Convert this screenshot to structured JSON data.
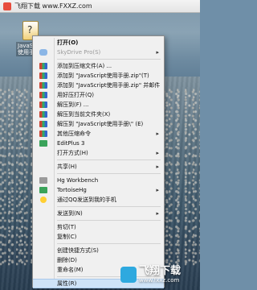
{
  "window": {
    "title": "飞翔下载 www.FXXZ.com"
  },
  "desktop": {
    "icon_label": "JavaScript使用手册"
  },
  "context_menu": {
    "items": [
      {
        "label": "打开(O)",
        "bold": true,
        "icon": "",
        "arrow": false,
        "disabled": false
      },
      {
        "label": "SkyDrive Pro(S)",
        "icon": "skydrive-icon",
        "arrow": true,
        "disabled": true
      },
      {
        "sep": true
      },
      {
        "label": "添加到压缩文件(A) ...",
        "icon": "rar-books-icon"
      },
      {
        "label": "添加到 \"JavaScript使用手册.zip\"(T)",
        "icon": "rar-books-icon"
      },
      {
        "label": "添加到 \"JavaScript使用手册.zip\" 并邮件",
        "icon": "rar-books-icon"
      },
      {
        "label": "用好压打开(Q)",
        "icon": "rar-books-icon"
      },
      {
        "label": "解压到(F) ...",
        "icon": "rar-books-icon"
      },
      {
        "label": "解压到当前文件夹(X)",
        "icon": "rar-books-icon"
      },
      {
        "label": "解压到 \"JavaScript使用手册\\\" (E)",
        "icon": "rar-books-icon"
      },
      {
        "label": "其他压缩命令",
        "icon": "rar-books-icon",
        "arrow": true
      },
      {
        "label": "EditPlus 3",
        "icon": "editplus-icon"
      },
      {
        "label": "打开方式(H)",
        "icon": "",
        "arrow": true
      },
      {
        "sep": true
      },
      {
        "label": "共享(H)",
        "icon": "",
        "arrow": true
      },
      {
        "sep": true
      },
      {
        "label": "Hg Workbench",
        "icon": "hg-icon"
      },
      {
        "label": "TortoiseHg",
        "icon": "tortoisehg-icon",
        "arrow": true
      },
      {
        "label": "通过QQ发送到我的手机",
        "icon": "qq-icon"
      },
      {
        "sep": true
      },
      {
        "label": "发送到(N)",
        "icon": "",
        "arrow": true
      },
      {
        "sep": true
      },
      {
        "label": "剪切(T)",
        "icon": ""
      },
      {
        "label": "复制(C)",
        "icon": ""
      },
      {
        "sep": true
      },
      {
        "label": "创建快捷方式(S)",
        "icon": ""
      },
      {
        "label": "删除(D)",
        "icon": ""
      },
      {
        "label": "重命名(M)",
        "icon": ""
      },
      {
        "sep": true
      },
      {
        "label": "属性(R)",
        "icon": "",
        "highlight": true
      }
    ]
  },
  "watermark": {
    "line1": "飞翔下载",
    "line2": "www.fxxz.com"
  }
}
